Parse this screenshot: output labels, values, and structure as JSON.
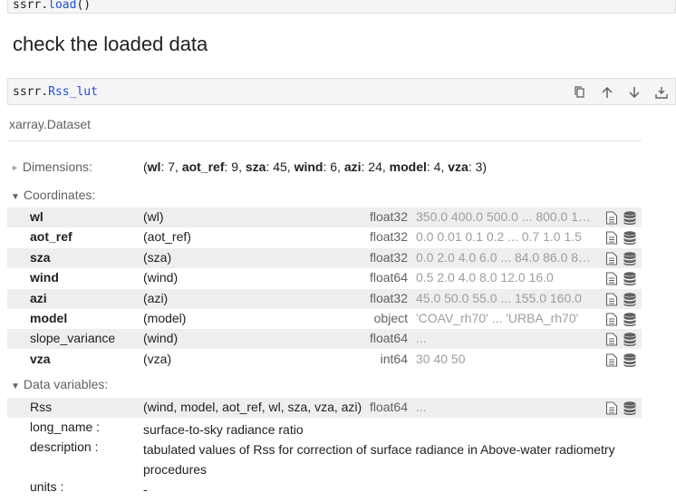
{
  "prev_cell": {
    "obj": "ssrr",
    "dot": ".",
    "fn": "load",
    "parens": "()"
  },
  "heading": "check the loaded data",
  "cell": {
    "obj": "ssrr",
    "dot": ".",
    "attr": "Rss_lut"
  },
  "toolbar": {
    "copy_icon": "copy-icon",
    "up_icon": "arrow-up-icon",
    "down_icon": "arrow-down-icon",
    "insert_icon": "insert-below-icon"
  },
  "xarray": {
    "type": "xarray.Dataset",
    "dimensions_label": "Dimensions:",
    "dims": [
      {
        "name": "wl",
        "size": "7"
      },
      {
        "name": "aot_ref",
        "size": "9"
      },
      {
        "name": "sza",
        "size": "45"
      },
      {
        "name": "wind",
        "size": "6"
      },
      {
        "name": "azi",
        "size": "24"
      },
      {
        "name": "model",
        "size": "4"
      },
      {
        "name": "vza",
        "size": "3"
      }
    ],
    "coordinates_label": "Coordinates:",
    "coordinates": [
      {
        "name": "wl",
        "dims": "(wl)",
        "dtype": "float32",
        "preview": "350.0 400.0 500.0 ... 800.0 1…",
        "bold": true
      },
      {
        "name": "aot_ref",
        "dims": "(aot_ref)",
        "dtype": "float32",
        "preview": "0.0 0.01 0.1 0.2 ... 0.7 1.0 1.5",
        "bold": true
      },
      {
        "name": "sza",
        "dims": "(sza)",
        "dtype": "float32",
        "preview": "0.0 2.0 4.0 6.0 ... 84.0 86.0 88.0",
        "bold": true
      },
      {
        "name": "wind",
        "dims": "(wind)",
        "dtype": "float64",
        "preview": "0.5 2.0 4.0 8.0 12.0 16.0",
        "bold": true
      },
      {
        "name": "azi",
        "dims": "(azi)",
        "dtype": "float32",
        "preview": "45.0 50.0 55.0 ... 155.0 160.0",
        "bold": true
      },
      {
        "name": "model",
        "dims": "(model)",
        "dtype": "object",
        "preview": "'COAV_rh70' ... 'URBA_rh70'",
        "bold": true
      },
      {
        "name": "slope_variance",
        "dims": "(wind)",
        "dtype": "float64",
        "preview": "...",
        "bold": false
      },
      {
        "name": "vza",
        "dims": "(vza)",
        "dtype": "int64",
        "preview": "30 40 50",
        "bold": true
      }
    ],
    "data_vars_label": "Data variables:",
    "data_vars": [
      {
        "name": "Rss",
        "dims": "(wind, model, aot_ref, wl, sza, vza, azi)",
        "dtype": "float64",
        "preview": "..."
      }
    ],
    "attrs": [
      {
        "key": "long_name :",
        "value": "surface-to-sky radiance ratio"
      },
      {
        "key": "description :",
        "value": "tabulated values of Rss for correction of surface radiance in Above-water radiometry procedures"
      },
      {
        "key": "units :",
        "value": "-"
      }
    ]
  }
}
